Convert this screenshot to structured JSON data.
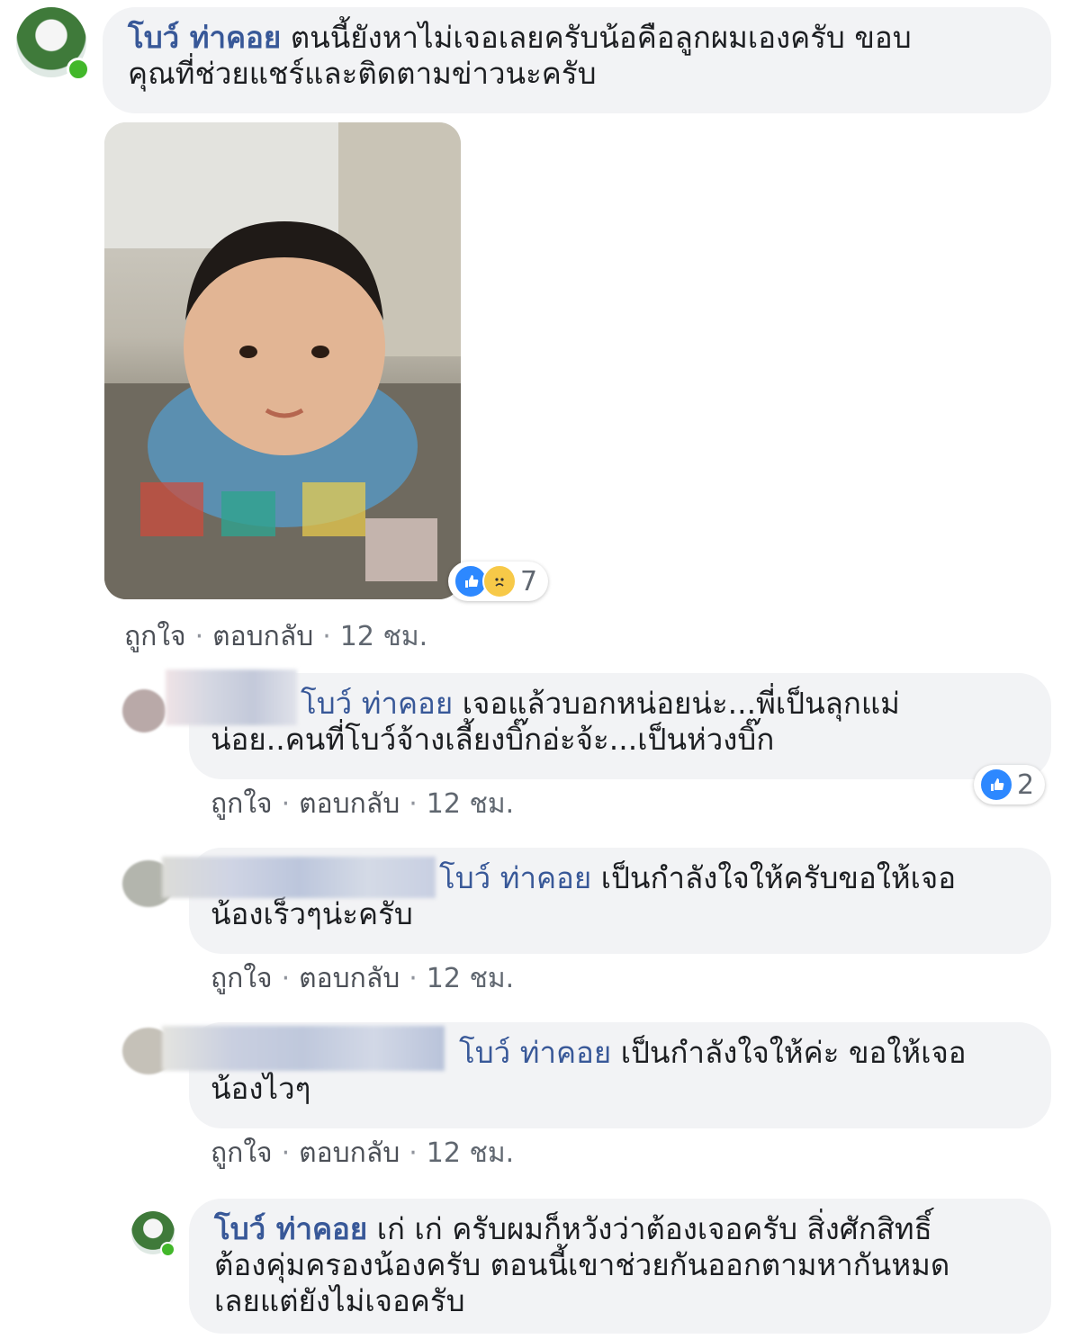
{
  "post_comment": {
    "author": "โบว์ ท่าคอย",
    "text_line1": " ตนนี้ยังหาไม่เจอเลยครับน้อคือลูกผมเองครับ ขอบ",
    "text_line2": "คุณที่ช่วยแชร์และติดตามข่าวนะครับ",
    "reaction_count": "7",
    "like_label": "ถูกใจ",
    "reply_label": "ตอบกลับ",
    "time": "12 ชม."
  },
  "replies": [
    {
      "mention": "โบว์ ท่าคอย",
      "text_line1": " เจอแล้วบอกหน่อยน่ะ...พี่เป็นลุกแม่",
      "text_line2": "น่อย..คนที่โบว์จ้างเลี้ยงบิ๊กอ่ะจ้ะ...เป็นห่วงบิ๊ก",
      "reaction_count": "2",
      "like_label": "ถูกใจ",
      "reply_label": "ตอบกลับ",
      "time": "12 ชม."
    },
    {
      "mention": "โบว์ ท่าคอย",
      "text_line1": " เป็นกำลังใจให้ครับขอให้เจอ",
      "text_line2": "น้องเร็วๆน่ะครับ",
      "like_label": "ถูกใจ",
      "reply_label": "ตอบกลับ",
      "time": "12 ชม."
    },
    {
      "mention": "โบว์ ท่าคอย",
      "text_line1": " เป็นกำลังใจให้ค่ะ ขอให้เจอ",
      "text_line2": "น้องไวๆ",
      "like_label": "ถูกใจ",
      "reply_label": "ตอบกลับ",
      "time": "12 ชม."
    },
    {
      "author": "โบว์ ท่าคอย",
      "text_line1": " เก่ เก่ ครับผมก็หวังว่าต้องเจอครับ สิ่งศักสิทธิ์",
      "text_line2": "ต้องคุ่มครองน้องครับ ตอนนี้เขาช่วยกันออกตามหากันหมด",
      "text_line3": "เลยแต่ยังไม่เจอครับ"
    }
  ],
  "colors": {
    "author_blue": "#385898",
    "bubble_bg": "#f2f3f5",
    "like_blue": "#2d88ff",
    "online_green": "#42b72a"
  }
}
